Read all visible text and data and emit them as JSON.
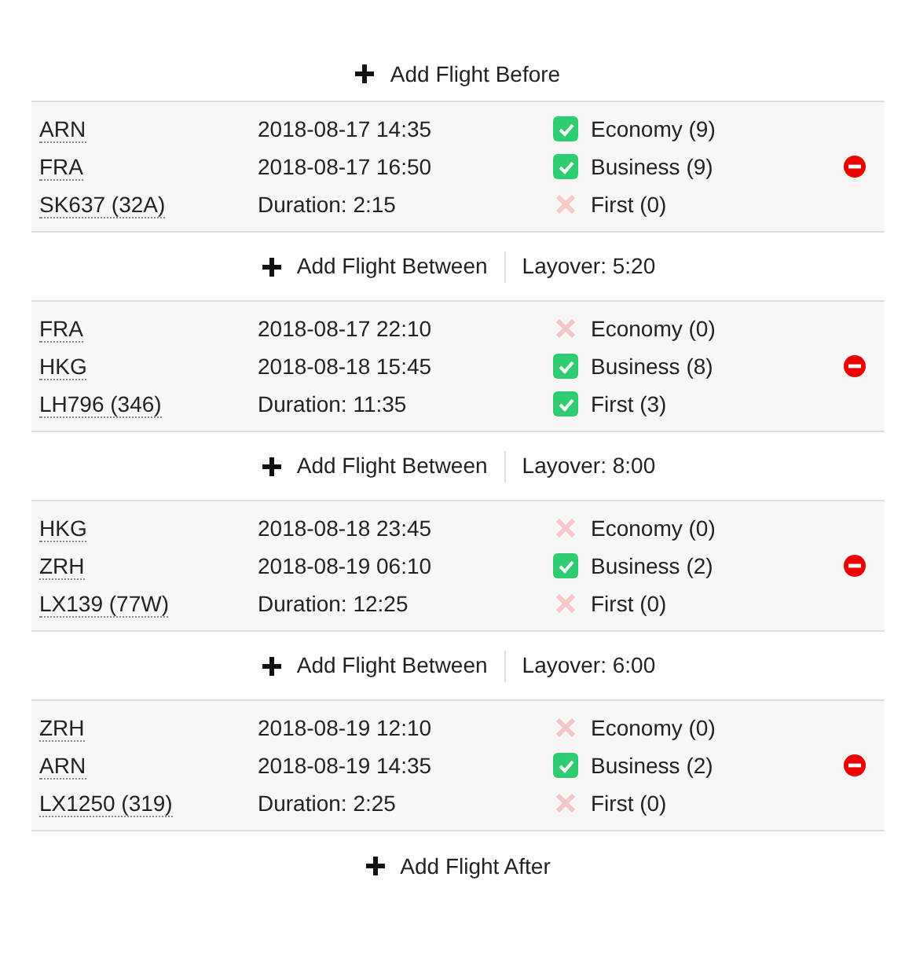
{
  "add_before": {
    "label": "Add Flight Before"
  },
  "flights": [
    {
      "origin": "ARN",
      "destination": "FRA",
      "flight": "SK637 (32A)",
      "departure": "2018-08-17 14:35",
      "arrival": "2018-08-17 16:50",
      "duration": "Duration: 2:15",
      "classes": [
        {
          "label": "Economy (9)",
          "checked": true
        },
        {
          "label": "Business (9)",
          "checked": true
        },
        {
          "label": "First (0)",
          "checked": false
        }
      ]
    },
    {
      "origin": "FRA",
      "destination": "HKG",
      "flight": "LH796 (346)",
      "departure": "2018-08-17 22:10",
      "arrival": "2018-08-18 15:45",
      "duration": "Duration: 11:35",
      "classes": [
        {
          "label": "Economy (0)",
          "checked": false
        },
        {
          "label": "Business (8)",
          "checked": true
        },
        {
          "label": "First (3)",
          "checked": true
        }
      ]
    },
    {
      "origin": "HKG",
      "destination": "ZRH",
      "flight": "LX139 (77W)",
      "departure": "2018-08-18 23:45",
      "arrival": "2018-08-19 06:10",
      "duration": "Duration: 12:25",
      "classes": [
        {
          "label": "Economy (0)",
          "checked": false
        },
        {
          "label": "Business (2)",
          "checked": true
        },
        {
          "label": "First (0)",
          "checked": false
        }
      ]
    },
    {
      "origin": "ZRH",
      "destination": "ARN",
      "flight": "LX1250 (319)",
      "departure": "2018-08-19 12:10",
      "arrival": "2018-08-19 14:35",
      "duration": "Duration: 2:25",
      "classes": [
        {
          "label": "Economy (0)",
          "checked": false
        },
        {
          "label": "Business (2)",
          "checked": true
        },
        {
          "label": "First (0)",
          "checked": false
        }
      ]
    }
  ],
  "between": [
    {
      "label": "Add Flight Between",
      "layover": "Layover: 5:20"
    },
    {
      "label": "Add Flight Between",
      "layover": "Layover: 8:00"
    },
    {
      "label": "Add Flight Between",
      "layover": "Layover: 6:00"
    }
  ],
  "add_after": {
    "label": "Add Flight After"
  }
}
